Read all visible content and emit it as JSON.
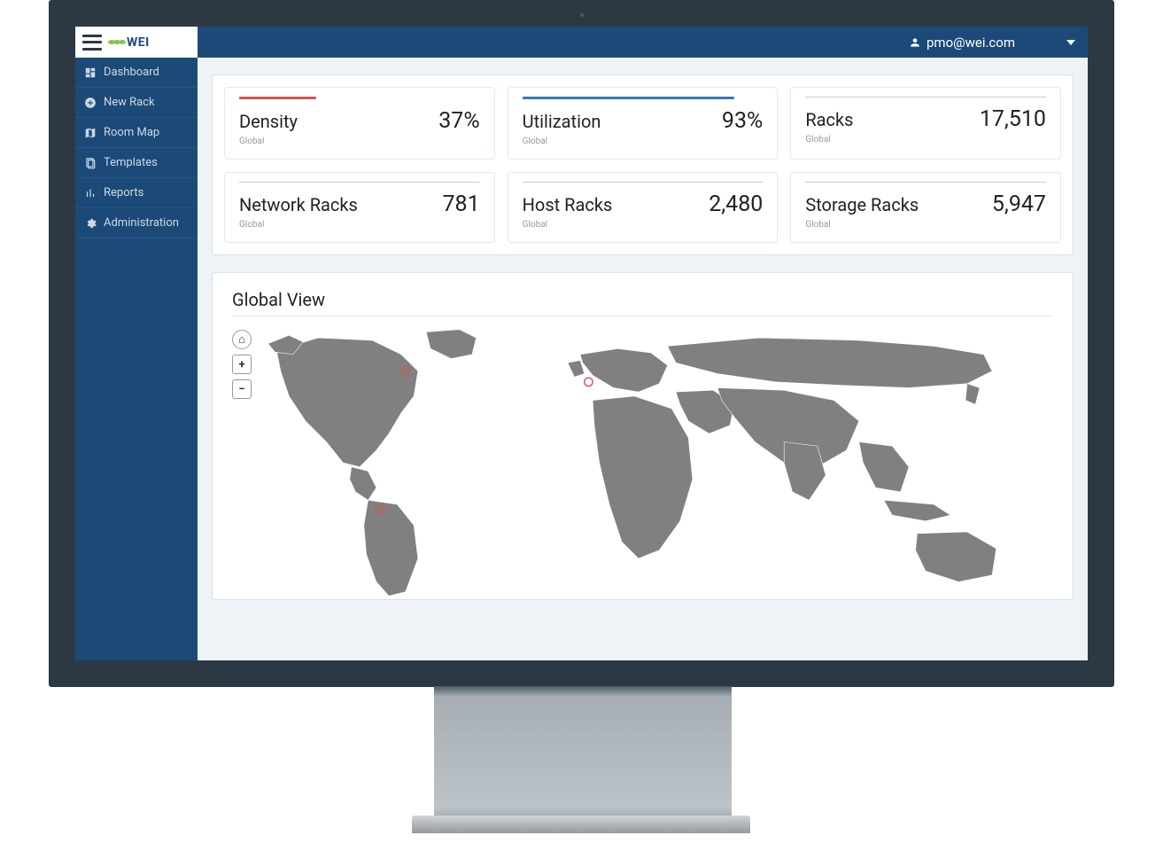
{
  "header": {
    "logo_text": "WEI",
    "user_email": "pmo@wei.com"
  },
  "sidebar": {
    "items": [
      {
        "icon": "dashboard-icon",
        "label": "Dashboard"
      },
      {
        "icon": "plus-icon",
        "label": "New Rack"
      },
      {
        "icon": "map-icon",
        "label": "Room Map"
      },
      {
        "icon": "templates-icon",
        "label": "Templates"
      },
      {
        "icon": "chart-icon",
        "label": "Reports"
      },
      {
        "icon": "gear-icon",
        "label": "Administration"
      }
    ]
  },
  "metrics": [
    {
      "title": "Density",
      "sub": "Global",
      "value": "37%",
      "bar": "red"
    },
    {
      "title": "Utilization",
      "sub": "Global",
      "value": "93%",
      "bar": "blue"
    },
    {
      "title": "Racks",
      "sub": "Global",
      "value": "17,510",
      "bar": "none"
    },
    {
      "title": "Network Racks",
      "sub": "Global",
      "value": "781",
      "bar": "none"
    },
    {
      "title": "Host Racks",
      "sub": "Global",
      "value": "2,480",
      "bar": "none"
    },
    {
      "title": "Storage Racks",
      "sub": "Global",
      "value": "5,947",
      "bar": "none"
    }
  ],
  "map": {
    "title": "Global View",
    "home": "⌂",
    "zoom_in": "+",
    "zoom_out": "−"
  }
}
